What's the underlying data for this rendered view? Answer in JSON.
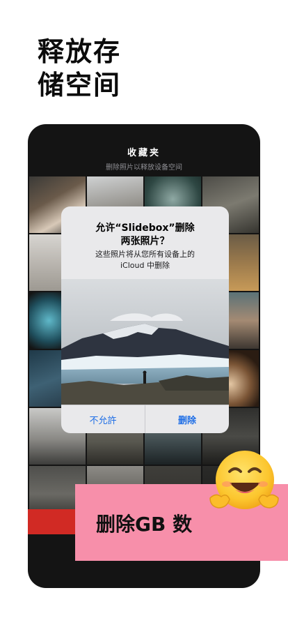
{
  "headline": {
    "line1": "释放存",
    "line2": "储空间"
  },
  "phone": {
    "title": "收藏夹",
    "subtitle": "删除照片以释放设备空间"
  },
  "dialog": {
    "title_line1": "允许“Slidebox”删除",
    "title_line2": "两张照片？",
    "message_line1": "这些照片将从您所有设备上的",
    "message_line2": "iCloud 中删除",
    "deny_label": "不允許",
    "delete_label": "删除"
  },
  "promo": {
    "label": "删除GB 数"
  },
  "colors": {
    "accent_blue": "#1e6ee6",
    "promo_pink": "#f78faa",
    "alert_red": "#d12a24",
    "phone_bg": "#141414"
  },
  "icons": {
    "emoji": "smiling-face-with-open-hands-emoji"
  }
}
